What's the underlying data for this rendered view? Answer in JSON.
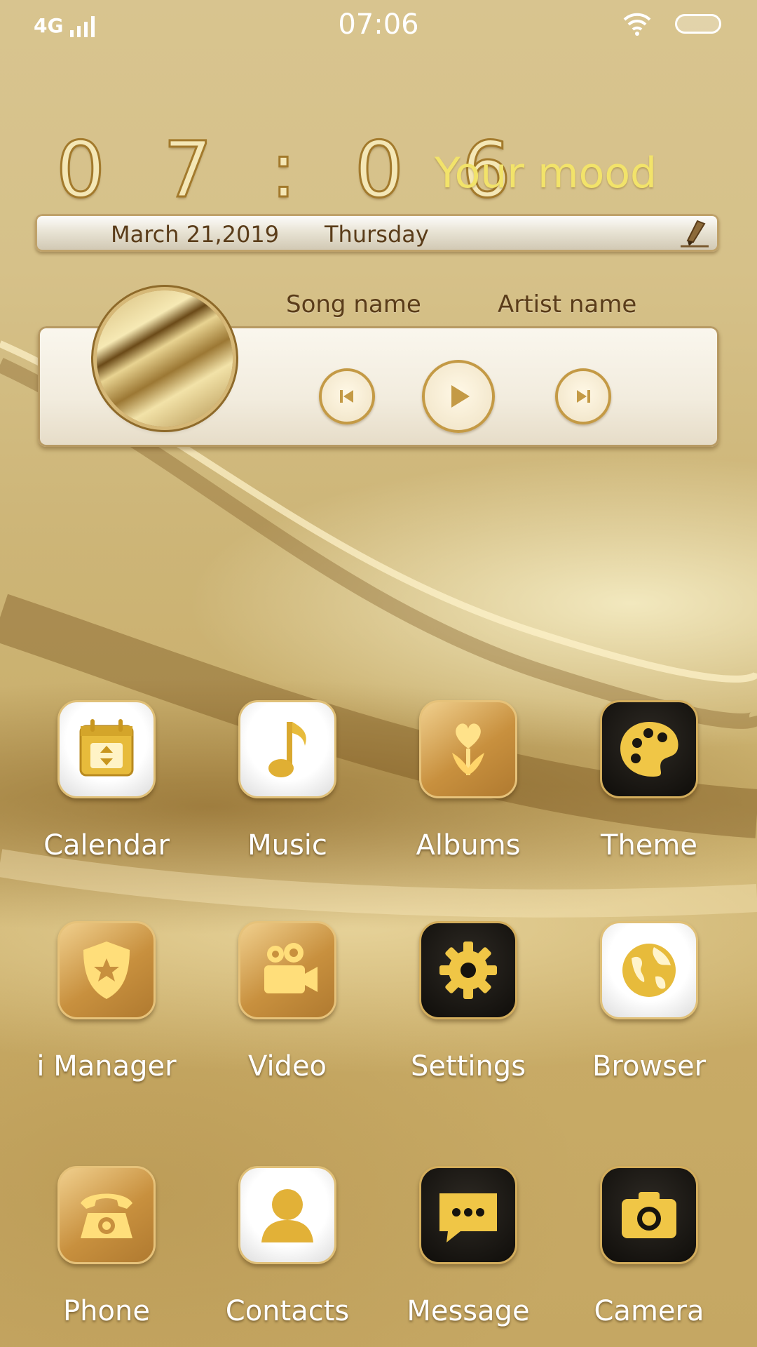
{
  "status_bar": {
    "network": "4G",
    "time": "07:06"
  },
  "clock_widget": {
    "time": "0 7 : 0 6",
    "mood": "Your mood",
    "date": "March 21,2019",
    "weekday": "Thursday"
  },
  "music_widget": {
    "song_name": "Song name",
    "artist_name": "Artist name"
  },
  "apps": [
    {
      "label": "Calendar",
      "icon": "calendar-icon",
      "style": "white"
    },
    {
      "label": "Music",
      "icon": "music-note-icon",
      "style": "white"
    },
    {
      "label": "Albums",
      "icon": "tulip-icon",
      "style": "gold"
    },
    {
      "label": "Theme",
      "icon": "palette-icon",
      "style": "black"
    },
    {
      "label": "i Manager",
      "icon": "shield-star-icon",
      "style": "gold"
    },
    {
      "label": "Video",
      "icon": "video-camera-icon",
      "style": "gold"
    },
    {
      "label": "Settings",
      "icon": "gear-icon",
      "style": "black"
    },
    {
      "label": "Browser",
      "icon": "globe-icon",
      "style": "white"
    },
    {
      "label": "Phone",
      "icon": "telephone-icon",
      "style": "gold"
    },
    {
      "label": "Contacts",
      "icon": "person-icon",
      "style": "white"
    },
    {
      "label": "Message",
      "icon": "chat-bubble-icon",
      "style": "black"
    },
    {
      "label": "Camera",
      "icon": "camera-icon",
      "style": "black"
    }
  ],
  "colors": {
    "gold": "#c8903e",
    "mood_text": "#f2e36a",
    "label_text": "#ffffff",
    "date_text": "#5a3c19"
  }
}
